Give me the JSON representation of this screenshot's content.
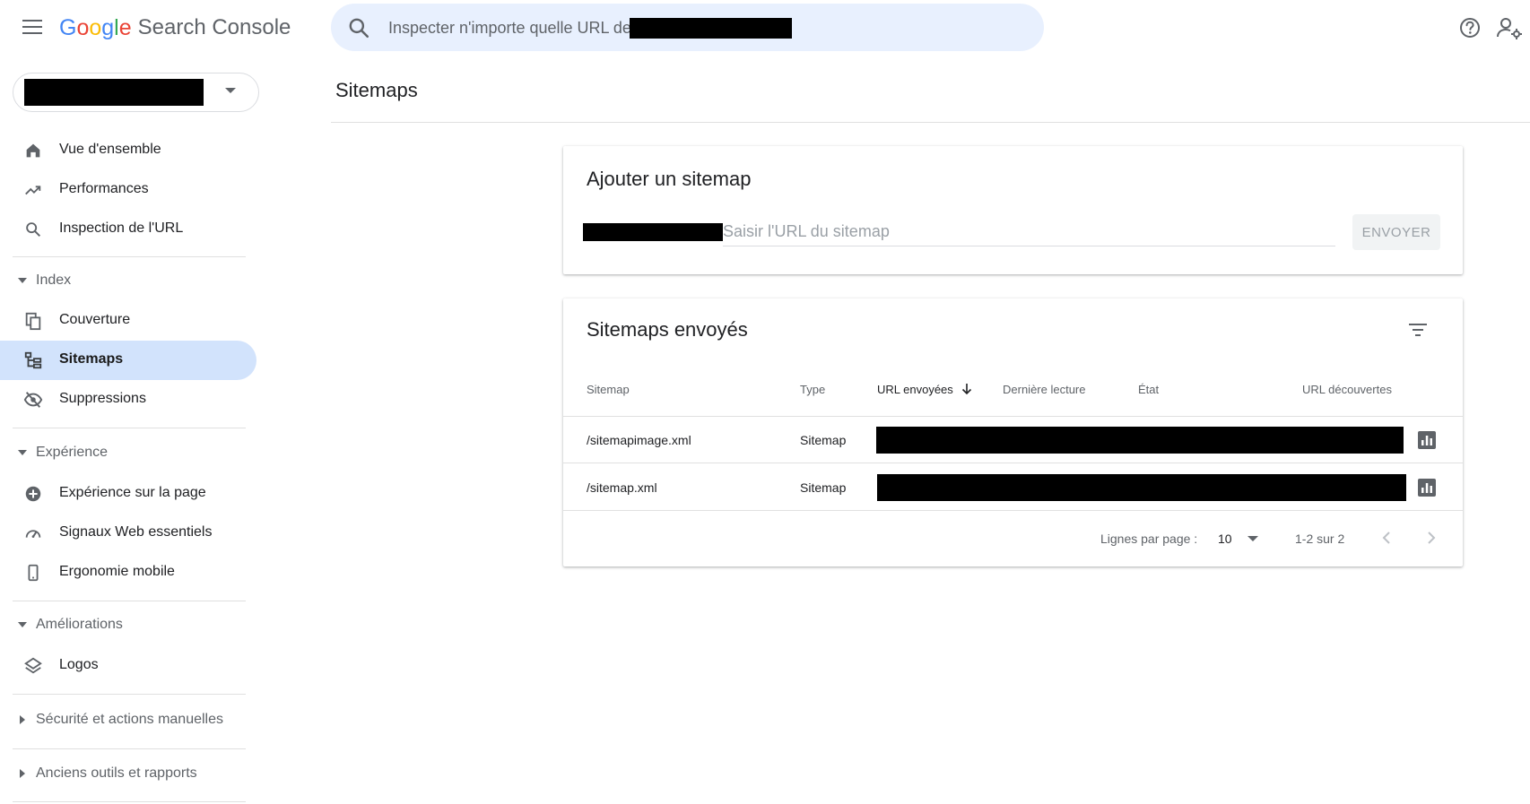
{
  "header": {
    "logo": {
      "g1": "G",
      "o1": "o",
      "o2": "o",
      "g2": "g",
      "l": "l",
      "e": "e",
      "product": "Search Console"
    },
    "search_placeholder": "Inspecter n'importe quelle URL de"
  },
  "sidebar": {
    "items": [
      {
        "label": "Vue d'ensemble",
        "icon": "home-icon"
      },
      {
        "label": "Performances",
        "icon": "trending-up-icon"
      },
      {
        "label": "Inspection de l'URL",
        "icon": "search-icon"
      }
    ],
    "sections": [
      {
        "label": "Index",
        "expanded": true,
        "items": [
          {
            "label": "Couverture",
            "icon": "copy-icon"
          },
          {
            "label": "Sitemaps",
            "icon": "sitemap-icon",
            "active": true
          },
          {
            "label": "Suppressions",
            "icon": "eye-off-icon"
          }
        ]
      },
      {
        "label": "Expérience",
        "expanded": true,
        "items": [
          {
            "label": "Expérience sur la page",
            "icon": "plus-circle-icon"
          },
          {
            "label": "Signaux Web essentiels",
            "icon": "speedometer-icon"
          },
          {
            "label": "Ergonomie mobile",
            "icon": "smartphone-icon"
          }
        ]
      },
      {
        "label": "Améliorations",
        "expanded": true,
        "items": [
          {
            "label": "Logos",
            "icon": "layers-icon"
          }
        ]
      },
      {
        "label": "Sécurité et actions manuelles",
        "expanded": false
      },
      {
        "label": "Anciens outils et rapports",
        "expanded": false
      }
    ]
  },
  "main": {
    "page_title": "Sitemaps",
    "add_card": {
      "title": "Ajouter un sitemap",
      "input_placeholder": "Saisir l'URL du sitemap",
      "input_value": "",
      "submit_label": "ENVOYER"
    },
    "list_card": {
      "title": "Sitemaps envoyés",
      "columns": [
        "Sitemap",
        "Type",
        "URL envoyées",
        "Dernière lecture",
        "État",
        "URL découvertes"
      ],
      "rows": [
        {
          "sitemap": "/sitemapimage.xml",
          "type": "Sitemap"
        },
        {
          "sitemap": "/sitemap.xml",
          "type": "Sitemap"
        }
      ],
      "pagination": {
        "rows_per_page_label": "Lignes par page :",
        "rows_per_page": "10",
        "range": "1-2 sur 2"
      }
    }
  },
  "colors": {
    "accent": "#1a73e8",
    "active_nav": "#d2e3fc",
    "search_bg": "#e8f0fe"
  }
}
